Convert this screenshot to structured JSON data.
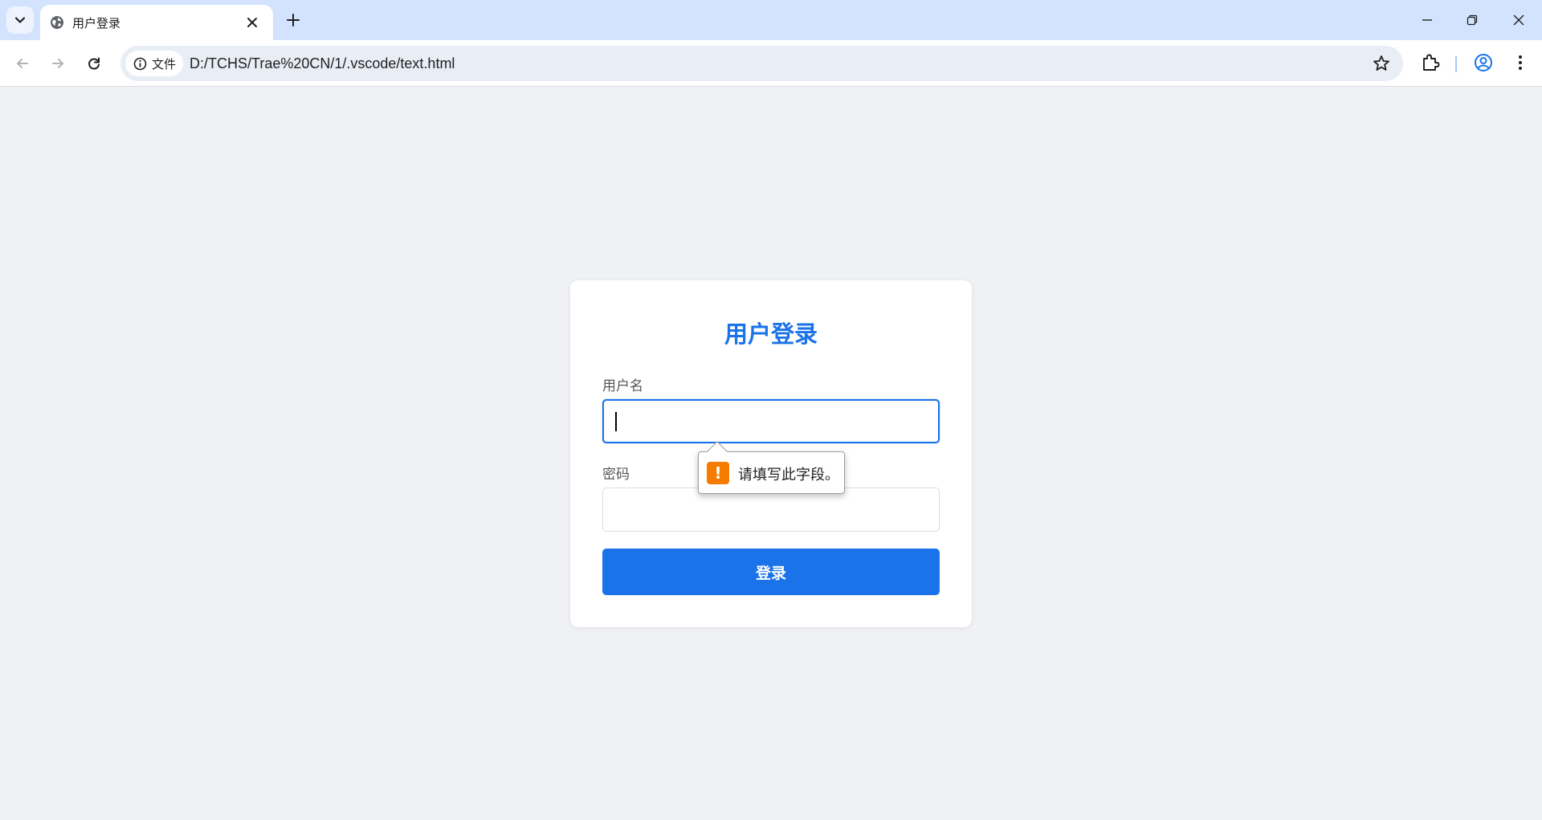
{
  "tab": {
    "title": "用户登录"
  },
  "toolbar": {
    "security_chip_label": "文件",
    "url": "D:/TCHS/Trae%20CN/1/.vscode/text.html"
  },
  "login": {
    "title": "用户登录",
    "username_label": "用户名",
    "username_value": "",
    "password_label": "密码",
    "password_value": "",
    "submit_label": "登录"
  },
  "validation": {
    "icon_text": "!",
    "message": "请填写此字段。"
  },
  "colors": {
    "accent": "#1a73e8",
    "warning": "#f57c00",
    "page_background": "#eff1f5",
    "tabbar_background": "#d3e3fd"
  },
  "icons": {
    "tab_search": "chevron-down-icon",
    "favicon": "globe-icon",
    "tab_close": "close-icon",
    "new_tab": "plus-icon",
    "back": "arrow-left-icon",
    "forward": "arrow-right-icon",
    "reload": "reload-icon",
    "site_info": "info-icon",
    "bookmark": "star-icon",
    "extensions": "puzzle-icon",
    "profile": "account-icon",
    "menu": "more-vert-icon",
    "warning": "warning-icon"
  }
}
